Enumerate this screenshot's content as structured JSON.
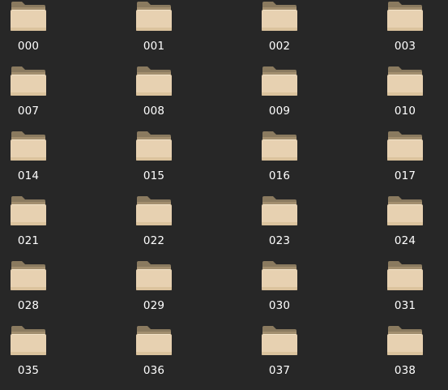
{
  "window": {
    "view": "icon-grid",
    "background_color": "#272727",
    "folder_icon": "folder-icon",
    "folder_colors": {
      "tab": "#8a7a5f",
      "back": "#a38f6f",
      "front": "#e7d1b1",
      "front_shade": "#d8bf99"
    }
  },
  "files": {
    "rows": [
      [
        {
          "name": "000",
          "type": "folder",
          "icon": "folder-icon"
        },
        {
          "name": "001",
          "type": "folder",
          "icon": "folder-icon"
        },
        {
          "name": "002",
          "type": "folder",
          "icon": "folder-icon"
        },
        {
          "name": "003",
          "type": "folder",
          "icon": "folder-icon"
        }
      ],
      [
        {
          "name": "007",
          "type": "folder",
          "icon": "folder-icon"
        },
        {
          "name": "008",
          "type": "folder",
          "icon": "folder-icon"
        },
        {
          "name": "009",
          "type": "folder",
          "icon": "folder-icon"
        },
        {
          "name": "010",
          "type": "folder",
          "icon": "folder-icon"
        }
      ],
      [
        {
          "name": "014",
          "type": "folder",
          "icon": "folder-icon"
        },
        {
          "name": "015",
          "type": "folder",
          "icon": "folder-icon"
        },
        {
          "name": "016",
          "type": "folder",
          "icon": "folder-icon"
        },
        {
          "name": "017",
          "type": "folder",
          "icon": "folder-icon"
        }
      ],
      [
        {
          "name": "021",
          "type": "folder",
          "icon": "folder-icon"
        },
        {
          "name": "022",
          "type": "folder",
          "icon": "folder-icon"
        },
        {
          "name": "023",
          "type": "folder",
          "icon": "folder-icon"
        },
        {
          "name": "024",
          "type": "folder",
          "icon": "folder-icon"
        }
      ],
      [
        {
          "name": "028",
          "type": "folder",
          "icon": "folder-icon"
        },
        {
          "name": "029",
          "type": "folder",
          "icon": "folder-icon"
        },
        {
          "name": "030",
          "type": "folder",
          "icon": "folder-icon"
        },
        {
          "name": "031",
          "type": "folder",
          "icon": "folder-icon"
        }
      ],
      [
        {
          "name": "035",
          "type": "folder",
          "icon": "folder-icon"
        },
        {
          "name": "036",
          "type": "folder",
          "icon": "folder-icon"
        },
        {
          "name": "037",
          "type": "folder",
          "icon": "folder-icon"
        },
        {
          "name": "038",
          "type": "folder",
          "icon": "folder-icon"
        }
      ]
    ]
  }
}
